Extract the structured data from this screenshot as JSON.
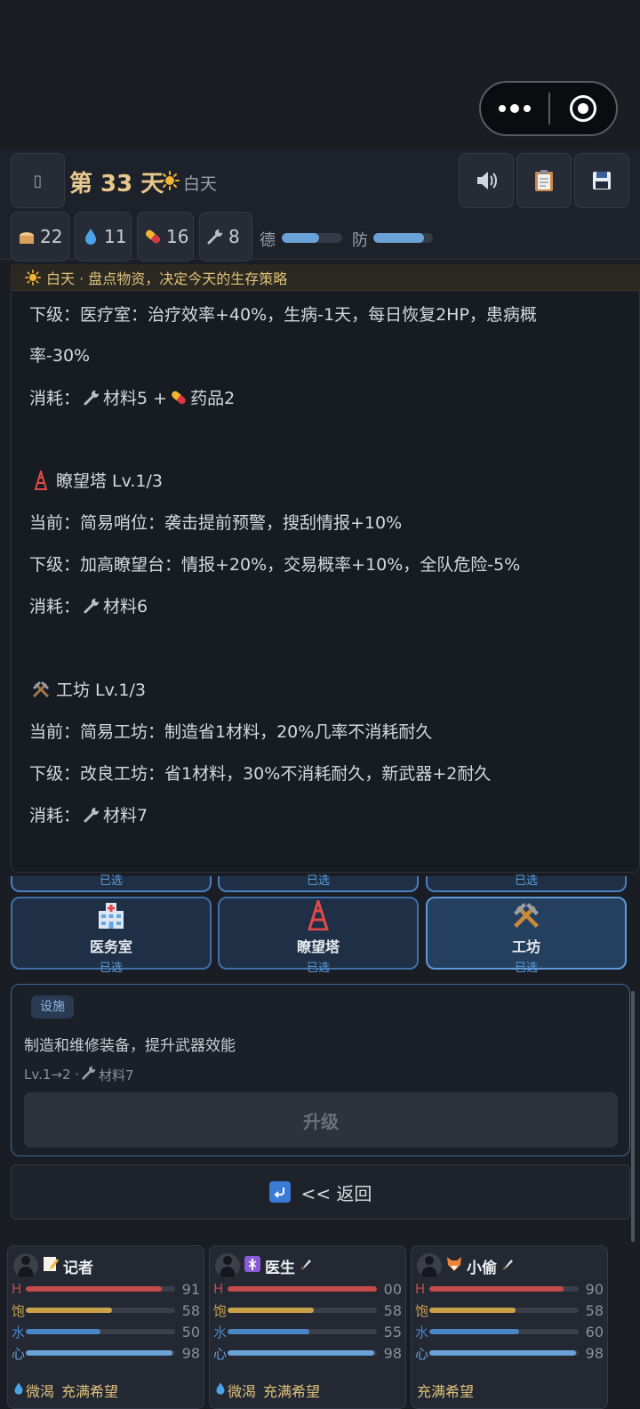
{
  "header": {
    "menu_icon": "hamburger-icon",
    "day_label": "第 33 天",
    "phase": "白天",
    "sound_icon": "speaker-icon",
    "log_icon": "clipboard-icon",
    "save_icon": "floppy-icon"
  },
  "resources": {
    "food": "22",
    "water": "11",
    "medicine": "16",
    "materials": "8"
  },
  "meters": {
    "morality_label": "德",
    "morality_level": 0.62,
    "defense_label": "防",
    "defense_level": 0.85
  },
  "notice": {
    "text": "白天 · 盘点物资，决定今天的生存策略"
  },
  "panel_text": {
    "med_next_1": "下级：医疗室：治疗效率+40%，生病-1天，每日恢复2HP，患病概",
    "med_next_2": "率-30%",
    "med_cost_prefix": "消耗：",
    "med_cost_mat": "材料5 +",
    "med_cost_med": "药品2",
    "tower_title": "瞭望塔  Lv.1/3",
    "tower_current": "当前：简易哨位：袭击提前预警，搜刮情报+10%",
    "tower_next": "下级：加高瞭望台：情报+20%，交易概率+10%，全队危险-5%",
    "tower_cost_prefix": "消耗：",
    "tower_cost_mat": "材料6",
    "work_title": "工坊  Lv.1/3",
    "work_current": "当前：简易工坊：制造省1材料，20%几率不消耗耐久",
    "work_next": "下级：改良工坊：省1材料，30%不消耗耐久，新武器+2耐久",
    "work_cost_prefix": "消耗：",
    "work_cost_mat": "材料7"
  },
  "facility_stubs": [
    "已选",
    "已选",
    "已选"
  ],
  "facilities": [
    {
      "name": "医务室",
      "status": "已选",
      "icon": "hospital-icon"
    },
    {
      "name": "瞭望塔",
      "status": "已选",
      "icon": "tower-icon"
    },
    {
      "name": "工坊",
      "status": "已选",
      "icon": "hammer-pick-icon"
    }
  ],
  "detail": {
    "tag": "设施",
    "description": "制造和维修装备，提升武器效能",
    "cost_prefix": "Lv.1→2 · ",
    "cost_mat": "材料7",
    "upgrade_label": "升级"
  },
  "back": {
    "label": "<< 返回"
  },
  "party": [
    {
      "name": "记者",
      "role_icon": "memo-icon",
      "weapon": false,
      "hp_label": "H",
      "hp": "91",
      "hp_level": 0.91,
      "food_label": "饱",
      "food": "58",
      "food_level": 0.58,
      "water_label": "水",
      "water": "50",
      "water_level": 0.5,
      "mind_label": "心",
      "mind": "98",
      "mind_level": 0.98,
      "status_thirst": "微渴",
      "status_mood": "充满希望"
    },
    {
      "name": "医生",
      "role_icon": "caduceus-icon",
      "weapon": true,
      "hp_label": "H",
      "hp": "00",
      "hp_level": 1.0,
      "food_label": "饱",
      "food": "58",
      "food_level": 0.58,
      "water_label": "水",
      "water": "55",
      "water_level": 0.55,
      "mind_label": "心",
      "mind": "98",
      "mind_level": 0.98,
      "status_thirst": "微渴",
      "status_mood": "充满希望"
    },
    {
      "name": "小偷",
      "role_icon": "fox-icon",
      "weapon": true,
      "hp_label": "H",
      "hp": "90",
      "hp_level": 0.9,
      "food_label": "饱",
      "food": "58",
      "food_level": 0.58,
      "water_label": "水",
      "water": "60",
      "water_level": 0.6,
      "mind_label": "心",
      "mind": "98",
      "mind_level": 0.98,
      "status_mood": "充满希望"
    }
  ],
  "colors": {
    "hp": "#c64a4a",
    "food": "#c9a34a",
    "water": "#4a86c6",
    "mind": "#6aa2d8",
    "accent": "#5e9ad8",
    "gold": "#e8c88c"
  }
}
